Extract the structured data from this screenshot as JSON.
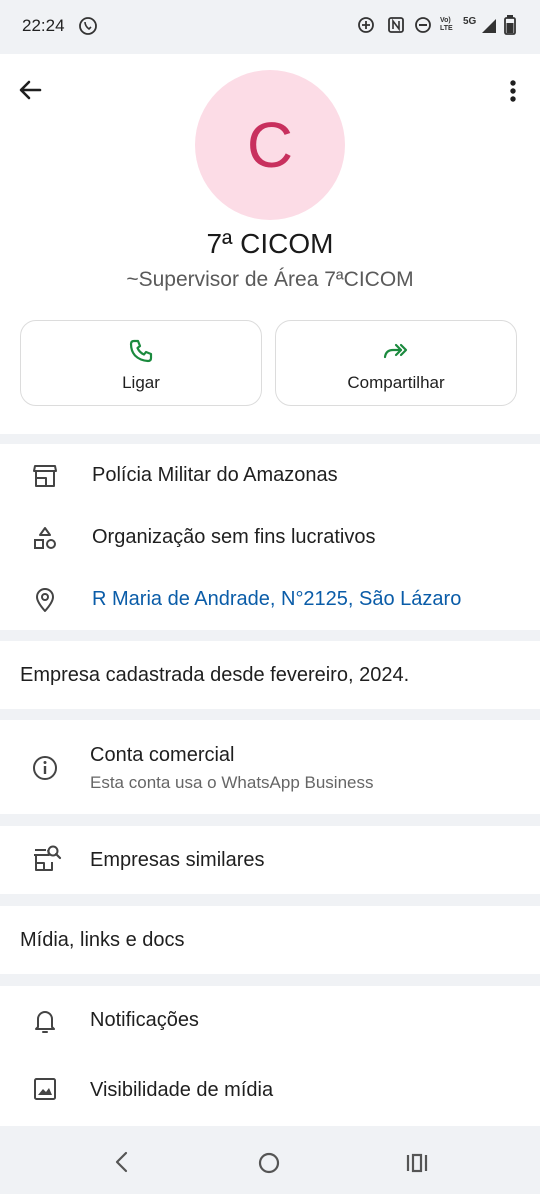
{
  "status_bar": {
    "time": "22:24",
    "network": "5G"
  },
  "profile": {
    "avatar_letter": "C",
    "name": "7ª CICOM",
    "subtitle": "~Supervisor de Área 7ªCICOM"
  },
  "actions": [
    {
      "label": "Ligar",
      "icon": "phone-icon"
    },
    {
      "label": "Compartilhar",
      "icon": "share-forward-icon"
    }
  ],
  "business_info": {
    "name": "Polícia Militar do Amazonas",
    "category": "Organização sem fins lucrativos",
    "address": "R Maria de Andrade, N°2125, São Lázaro"
  },
  "registered_since": "Empresa cadastrada desde fevereiro, 2024.",
  "account": {
    "title": "Conta comercial",
    "subtitle": "Esta conta usa o WhatsApp Business"
  },
  "similar": {
    "label": "Empresas similares"
  },
  "media": {
    "label": "Mídia, links e docs"
  },
  "settings": [
    {
      "label": "Notificações",
      "icon": "bell-icon"
    },
    {
      "label": "Visibilidade de mídia",
      "icon": "image-icon"
    }
  ],
  "colors": {
    "accent_green": "#1b8a3e",
    "link_blue": "#0a5ca8",
    "avatar_bg": "#fcdce6",
    "avatar_letter": "#c8305e"
  }
}
